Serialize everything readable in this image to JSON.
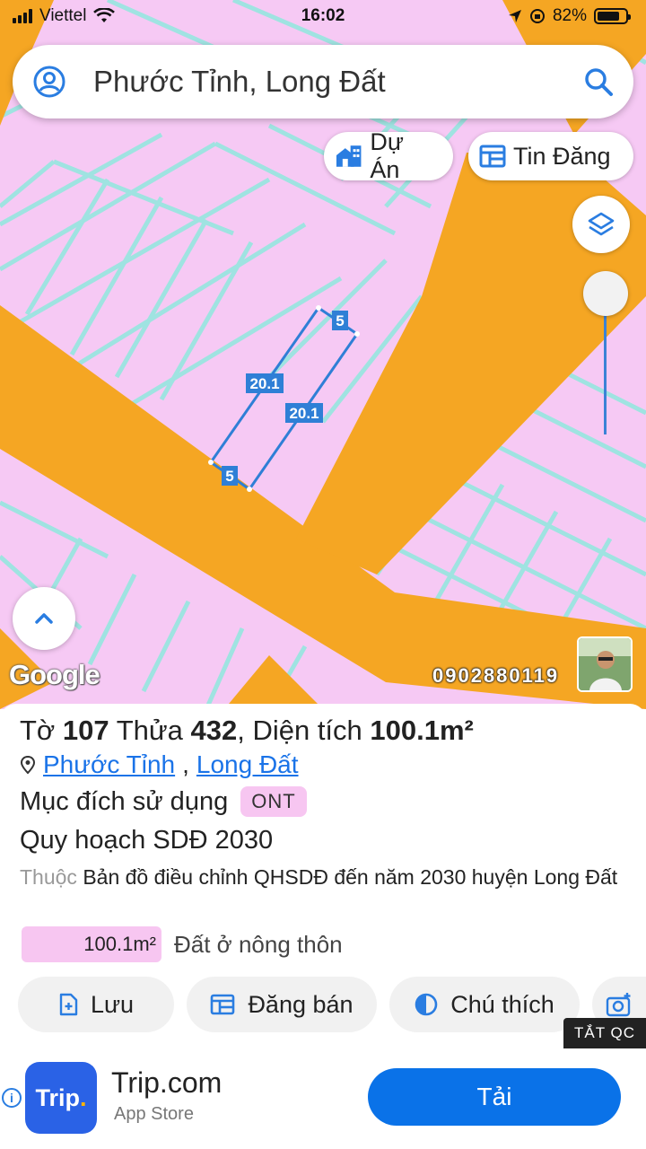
{
  "status_bar": {
    "carrier": "Viettel",
    "time": "16:02",
    "battery": "82%"
  },
  "search": {
    "value": "Phước Tỉnh, Long Đất"
  },
  "chips": {
    "projects_label": "Dự Án",
    "listings_label": "Tin Đăng"
  },
  "map": {
    "dimension_labels": [
      "5",
      "20.1",
      "20.1",
      "5"
    ],
    "watermark": "Google",
    "phone": "0902880119",
    "colors": {
      "residential": "#f6c9f4",
      "road": "#f5a623",
      "parcel_line": "#9be5e0",
      "selection": "#2f7fd6"
    }
  },
  "parcel": {
    "sheet_label": "Tờ",
    "sheet_no": "107",
    "plot_label": "Thửa",
    "plot_no": "432",
    "area_label": "Diện tích",
    "area": "100.1m²",
    "ward": "Phước Tỉnh",
    "district": "Long Đất",
    "usage_label": "Mục đích sử dụng",
    "usage_code": "ONT",
    "plan_title": "Quy hoạch SDĐ 2030",
    "belongs_prefix": "Thuộc",
    "belongs_text": "Bản đồ điều chỉnh QHSDĐ đến năm 2030 huyện Long Đất",
    "legend_area": "100.1m²",
    "legend_label": "Đất ở nông thôn"
  },
  "actions": {
    "save": "Lưu",
    "post_sale": "Đăng bán",
    "legend": "Chú thích"
  },
  "ad": {
    "tag": "TẮT QC",
    "logo_text": "Trip",
    "logo_dot": ".",
    "app_name": "Trip.com",
    "store": "App Store",
    "button": "Tải"
  }
}
